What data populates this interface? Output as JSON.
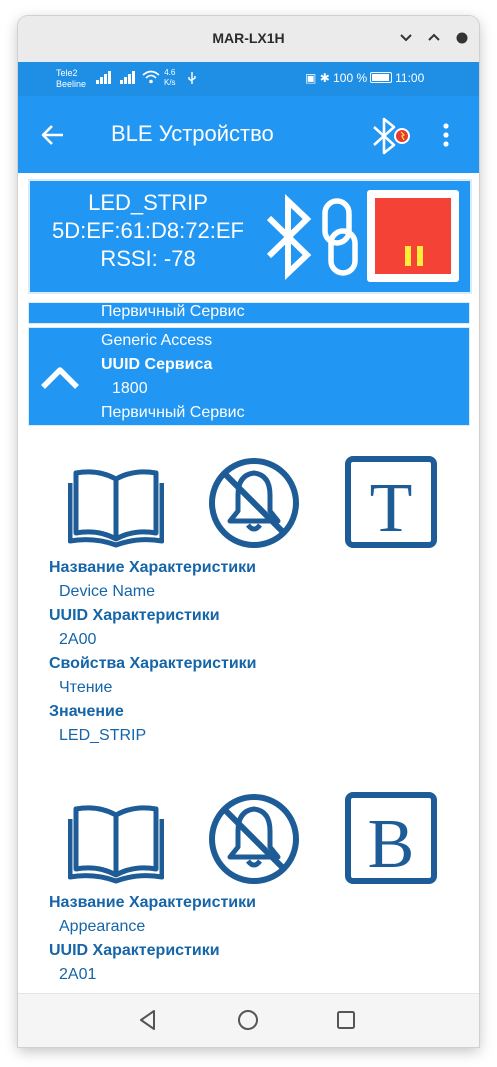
{
  "window": {
    "title": "MAR-LX1H"
  },
  "status_bar": {
    "carrier1": "Tele2",
    "carrier2": "Beeline",
    "net_speed_value": "4.6",
    "net_speed_unit": "K/s",
    "battery": "100 %",
    "time": "11:00"
  },
  "app_bar": {
    "title": "BLE Устройство"
  },
  "device": {
    "name": "LED_STRIP",
    "mac": "5D:EF:61:D8:72:EF",
    "rssi": "RSSI: -78"
  },
  "services": [
    {
      "type_label": "Первичный Сервис"
    },
    {
      "name": "Generic Access",
      "uuid_label": "UUID Сервиса",
      "uuid": "1800",
      "type_label": "Первичный Сервис"
    }
  ],
  "characteristics": [
    {
      "icons": [
        "read-book-icon",
        "notifications-off-icon",
        "text-format-T-icon"
      ],
      "name_label": "Название Характеристики",
      "name": "Device Name",
      "uuid_label": "UUID Характеристики",
      "uuid": "2A00",
      "props_label": "Свойства Характеристики",
      "props": "Чтение",
      "value_label": "Значение",
      "value": "LED_STRIP"
    },
    {
      "icons": [
        "read-book-icon",
        "notifications-off-icon",
        "binary-format-B-icon"
      ],
      "name_label": "Название Характеристики",
      "name": "Appearance",
      "uuid_label": "UUID Характеристики",
      "uuid": "2A01",
      "format_letter": "B"
    }
  ],
  "format_letters": {
    "text": "T",
    "binary": "B"
  },
  "colors": {
    "app_bar": "#2196f3",
    "status_bar": "#1f8fe6",
    "text_blue": "#1565a8",
    "stop_red": "#f44336",
    "pause_yellow": "#ffeb3b"
  }
}
